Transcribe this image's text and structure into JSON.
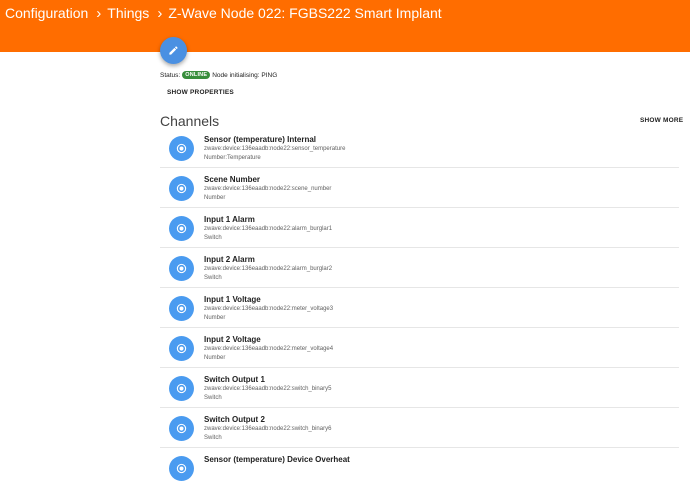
{
  "header": {
    "breadcrumbs": [
      "Configuration",
      "Things",
      "Z-Wave Node 022: FGBS222 Smart Implant"
    ],
    "separator": "›"
  },
  "status": {
    "label": "Status:",
    "badge": "ONLINE",
    "detail": "Node initialising: PING"
  },
  "show_properties": "SHOW PROPERTIES",
  "channels": {
    "title": "Channels",
    "show_more": "SHOW MORE",
    "items": [
      {
        "label": "Sensor (temperature) Internal",
        "uid": "zwave:device:136eaadb:node22:sensor_temperature",
        "type": "Number:Temperature"
      },
      {
        "label": "Scene Number",
        "uid": "zwave:device:136eaadb:node22:scene_number",
        "type": "Number"
      },
      {
        "label": "Input 1 Alarm",
        "uid": "zwave:device:136eaadb:node22:alarm_burglar1",
        "type": "Switch"
      },
      {
        "label": "Input 2 Alarm",
        "uid": "zwave:device:136eaadb:node22:alarm_burglar2",
        "type": "Switch"
      },
      {
        "label": "Input 1 Voltage",
        "uid": "zwave:device:136eaadb:node22:meter_voltage3",
        "type": "Number"
      },
      {
        "label": "Input 2 Voltage",
        "uid": "zwave:device:136eaadb:node22:meter_voltage4",
        "type": "Number"
      },
      {
        "label": "Switch Output 1",
        "uid": "zwave:device:136eaadb:node22:switch_binary5",
        "type": "Switch"
      },
      {
        "label": "Switch Output 2",
        "uid": "zwave:device:136eaadb:node22:switch_binary6",
        "type": "Switch"
      },
      {
        "label": "Sensor (temperature) Device Overheat",
        "uid": "",
        "type": ""
      }
    ]
  },
  "colors": {
    "header": "#ff6d00",
    "accent": "#4a9bf0",
    "online": "#388e3c"
  },
  "icons": {
    "edit": "pencil-icon",
    "channel": "radio-dot-icon"
  }
}
